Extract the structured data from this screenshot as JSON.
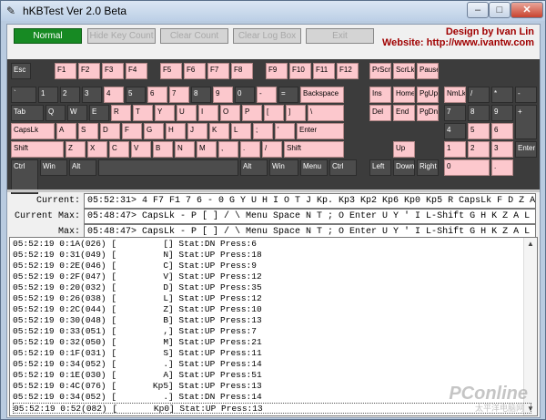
{
  "window": {
    "title": "hKBTest Ver 2.0 Beta",
    "min": "–",
    "max": "□",
    "close": "✕"
  },
  "toolbar": {
    "normal": "Normal",
    "hide_key_count": "Hide Key Count",
    "clear_count": "Clear Count",
    "clear_log_box": "Clear Log Box",
    "exit": "Exit"
  },
  "credits": {
    "designer": "Design by Ivan Lin",
    "website": "Website: http://www.ivantw.com"
  },
  "colors": {
    "highlight": "#fcc8cd",
    "key": "#4c4c4c",
    "keyboard_bg": "#3c3c3c",
    "active_button": "#178a23",
    "credit_text": "#a00000"
  },
  "keys": [
    {
      "label": "Esc",
      "hl": false
    },
    {
      "label": "F1",
      "hl": true
    },
    {
      "label": "F2",
      "hl": true
    },
    {
      "label": "F3",
      "hl": true
    },
    {
      "label": "F4",
      "hl": true
    },
    {
      "label": "F5",
      "hl": true
    },
    {
      "label": "F6",
      "hl": true
    },
    {
      "label": "F7",
      "hl": true
    },
    {
      "label": "F8",
      "hl": true
    },
    {
      "label": "F9",
      "hl": true
    },
    {
      "label": "F10",
      "hl": true
    },
    {
      "label": "F11",
      "hl": true
    },
    {
      "label": "F12",
      "hl": true
    },
    {
      "label": "PrScr",
      "hl": true
    },
    {
      "label": "ScrLk",
      "hl": true
    },
    {
      "label": "Pause",
      "hl": true
    },
    {
      "label": "`",
      "hl": false
    },
    {
      "label": "1",
      "hl": false
    },
    {
      "label": "2",
      "hl": false
    },
    {
      "label": "3",
      "hl": false
    },
    {
      "label": "4",
      "hl": true
    },
    {
      "label": "5",
      "hl": false
    },
    {
      "label": "6",
      "hl": true
    },
    {
      "label": "7",
      "hl": true
    },
    {
      "label": "8",
      "hl": false
    },
    {
      "label": "9",
      "hl": true
    },
    {
      "label": "0",
      "hl": false
    },
    {
      "label": "-",
      "hl": true
    },
    {
      "label": "=",
      "hl": false
    },
    {
      "label": "Backspace",
      "hl": true
    },
    {
      "label": "Ins",
      "hl": true
    },
    {
      "label": "Home",
      "hl": true
    },
    {
      "label": "PgUp",
      "hl": true
    },
    {
      "label": "NmLk",
      "hl": true
    },
    {
      "label": "/",
      "hl": false
    },
    {
      "label": "*",
      "hl": false
    },
    {
      "label": "-",
      "hl": false
    },
    {
      "label": "Tab",
      "hl": false
    },
    {
      "label": "Q",
      "hl": false
    },
    {
      "label": "W",
      "hl": false
    },
    {
      "label": "E",
      "hl": false
    },
    {
      "label": "R",
      "hl": true
    },
    {
      "label": "T",
      "hl": true
    },
    {
      "label": "Y",
      "hl": true
    },
    {
      "label": "U",
      "hl": true
    },
    {
      "label": "I",
      "hl": true
    },
    {
      "label": "O",
      "hl": true
    },
    {
      "label": "P",
      "hl": true
    },
    {
      "label": "[",
      "hl": true
    },
    {
      "label": "]",
      "hl": true
    },
    {
      "label": "\\",
      "hl": true
    },
    {
      "label": "Del",
      "hl": true
    },
    {
      "label": "End",
      "hl": true
    },
    {
      "label": "PgDn",
      "hl": true
    },
    {
      "label": "7",
      "hl": false
    },
    {
      "label": "8",
      "hl": false
    },
    {
      "label": "9",
      "hl": false
    },
    {
      "label": "+",
      "hl": false
    },
    {
      "label": "CapsLk",
      "hl": true
    },
    {
      "label": "A",
      "hl": true
    },
    {
      "label": "S",
      "hl": true
    },
    {
      "label": "D",
      "hl": true
    },
    {
      "label": "F",
      "hl": true
    },
    {
      "label": "G",
      "hl": true
    },
    {
      "label": "H",
      "hl": true
    },
    {
      "label": "J",
      "hl": true
    },
    {
      "label": "K",
      "hl": true
    },
    {
      "label": "L",
      "hl": true
    },
    {
      "label": ";",
      "hl": true
    },
    {
      "label": "'",
      "hl": true
    },
    {
      "label": "Enter",
      "hl": true
    },
    {
      "label": "4",
      "hl": false
    },
    {
      "label": "5",
      "hl": true
    },
    {
      "label": "6",
      "hl": true
    },
    {
      "label": "Shift",
      "hl": true
    },
    {
      "label": "Z",
      "hl": true
    },
    {
      "label": "X",
      "hl": true
    },
    {
      "label": "C",
      "hl": true
    },
    {
      "label": "V",
      "hl": true
    },
    {
      "label": "B",
      "hl": true
    },
    {
      "label": "N",
      "hl": true
    },
    {
      "label": "M",
      "hl": true
    },
    {
      "label": ",",
      "hl": true
    },
    {
      "label": ".",
      "hl": true
    },
    {
      "label": "/",
      "hl": true
    },
    {
      "label": "Shift",
      "hl": true
    },
    {
      "label": "Up",
      "hl": true
    },
    {
      "label": "1",
      "hl": true
    },
    {
      "label": "2",
      "hl": true
    },
    {
      "label": "3",
      "hl": true
    },
    {
      "label": "Enter",
      "hl": false
    },
    {
      "label": "Ctrl",
      "hl": false
    },
    {
      "label": "Win",
      "hl": false
    },
    {
      "label": "Alt",
      "hl": false
    },
    {
      "label": "",
      "hl": false
    },
    {
      "label": "Alt",
      "hl": false
    },
    {
      "label": "Win",
      "hl": false
    },
    {
      "label": "Menu",
      "hl": false
    },
    {
      "label": "Ctrl",
      "hl": false
    },
    {
      "label": "Left",
      "hl": false
    },
    {
      "label": "Down",
      "hl": false
    },
    {
      "label": "Right",
      "hl": false
    },
    {
      "label": "0",
      "hl": true
    },
    {
      "label": ".",
      "hl": true
    }
  ],
  "status": {
    "current_label": "Current:",
    "current_value": "05:52:31> 4 F7 F1 7 6 - 0 G Y U H I O T J Kp. Kp3 Kp2 Kp6 Kp0 Kp5 R CapsLk F D Z A C",
    "current_max_label": "Current Max:",
    "current_max_value": "05:48:47> CapsLk - P [ ] / \\ Menu Space N T ; O Enter U Y ' I L-Shift G H K Z A L S C",
    "max_label": "Max:",
    "max_value": "05:48:47> CapsLk - P [ ] / \\ Menu Space N T ; O Enter U Y ' I L-Shift G H K Z A L S C"
  },
  "log": [
    "05:52:19 0:1A(026) [         [] Stat:DN Press:6",
    "05:52:19 0:31(049) [         N] Stat:UP Press:18",
    "05:52:19 0:2E(046) [         C] Stat:UP Press:9",
    "05:52:19 0:2F(047) [         V] Stat:UP Press:12",
    "05:52:19 0:20(032) [         D] Stat:UP Press:35",
    "05:52:19 0:26(038) [         L] Stat:UP Press:12",
    "05:52:19 0:2C(044) [         Z] Stat:UP Press:10",
    "05:52:19 0:30(048) [         B] Stat:UP Press:13",
    "05:52:19 0:33(051) [         ,] Stat:UP Press:7",
    "05:52:19 0:32(050) [         M] Stat:UP Press:21",
    "05:52:19 0:1F(031) [         S] Stat:UP Press:11",
    "05:52:19 0:34(052) [         .] Stat:UP Press:14",
    "05:52:19 0:1E(030) [         A] Stat:UP Press:51",
    "05:52:19 0:4C(076) [       Kp5] Stat:UP Press:13",
    "05:52:19 0:34(052) [         .] Stat:DN Press:14",
    "05:52:19 0:52(082) [       Kp0] Stat:UP Press:13"
  ],
  "watermark": {
    "main": "PConline",
    "sub": "太平洋电脑网"
  }
}
